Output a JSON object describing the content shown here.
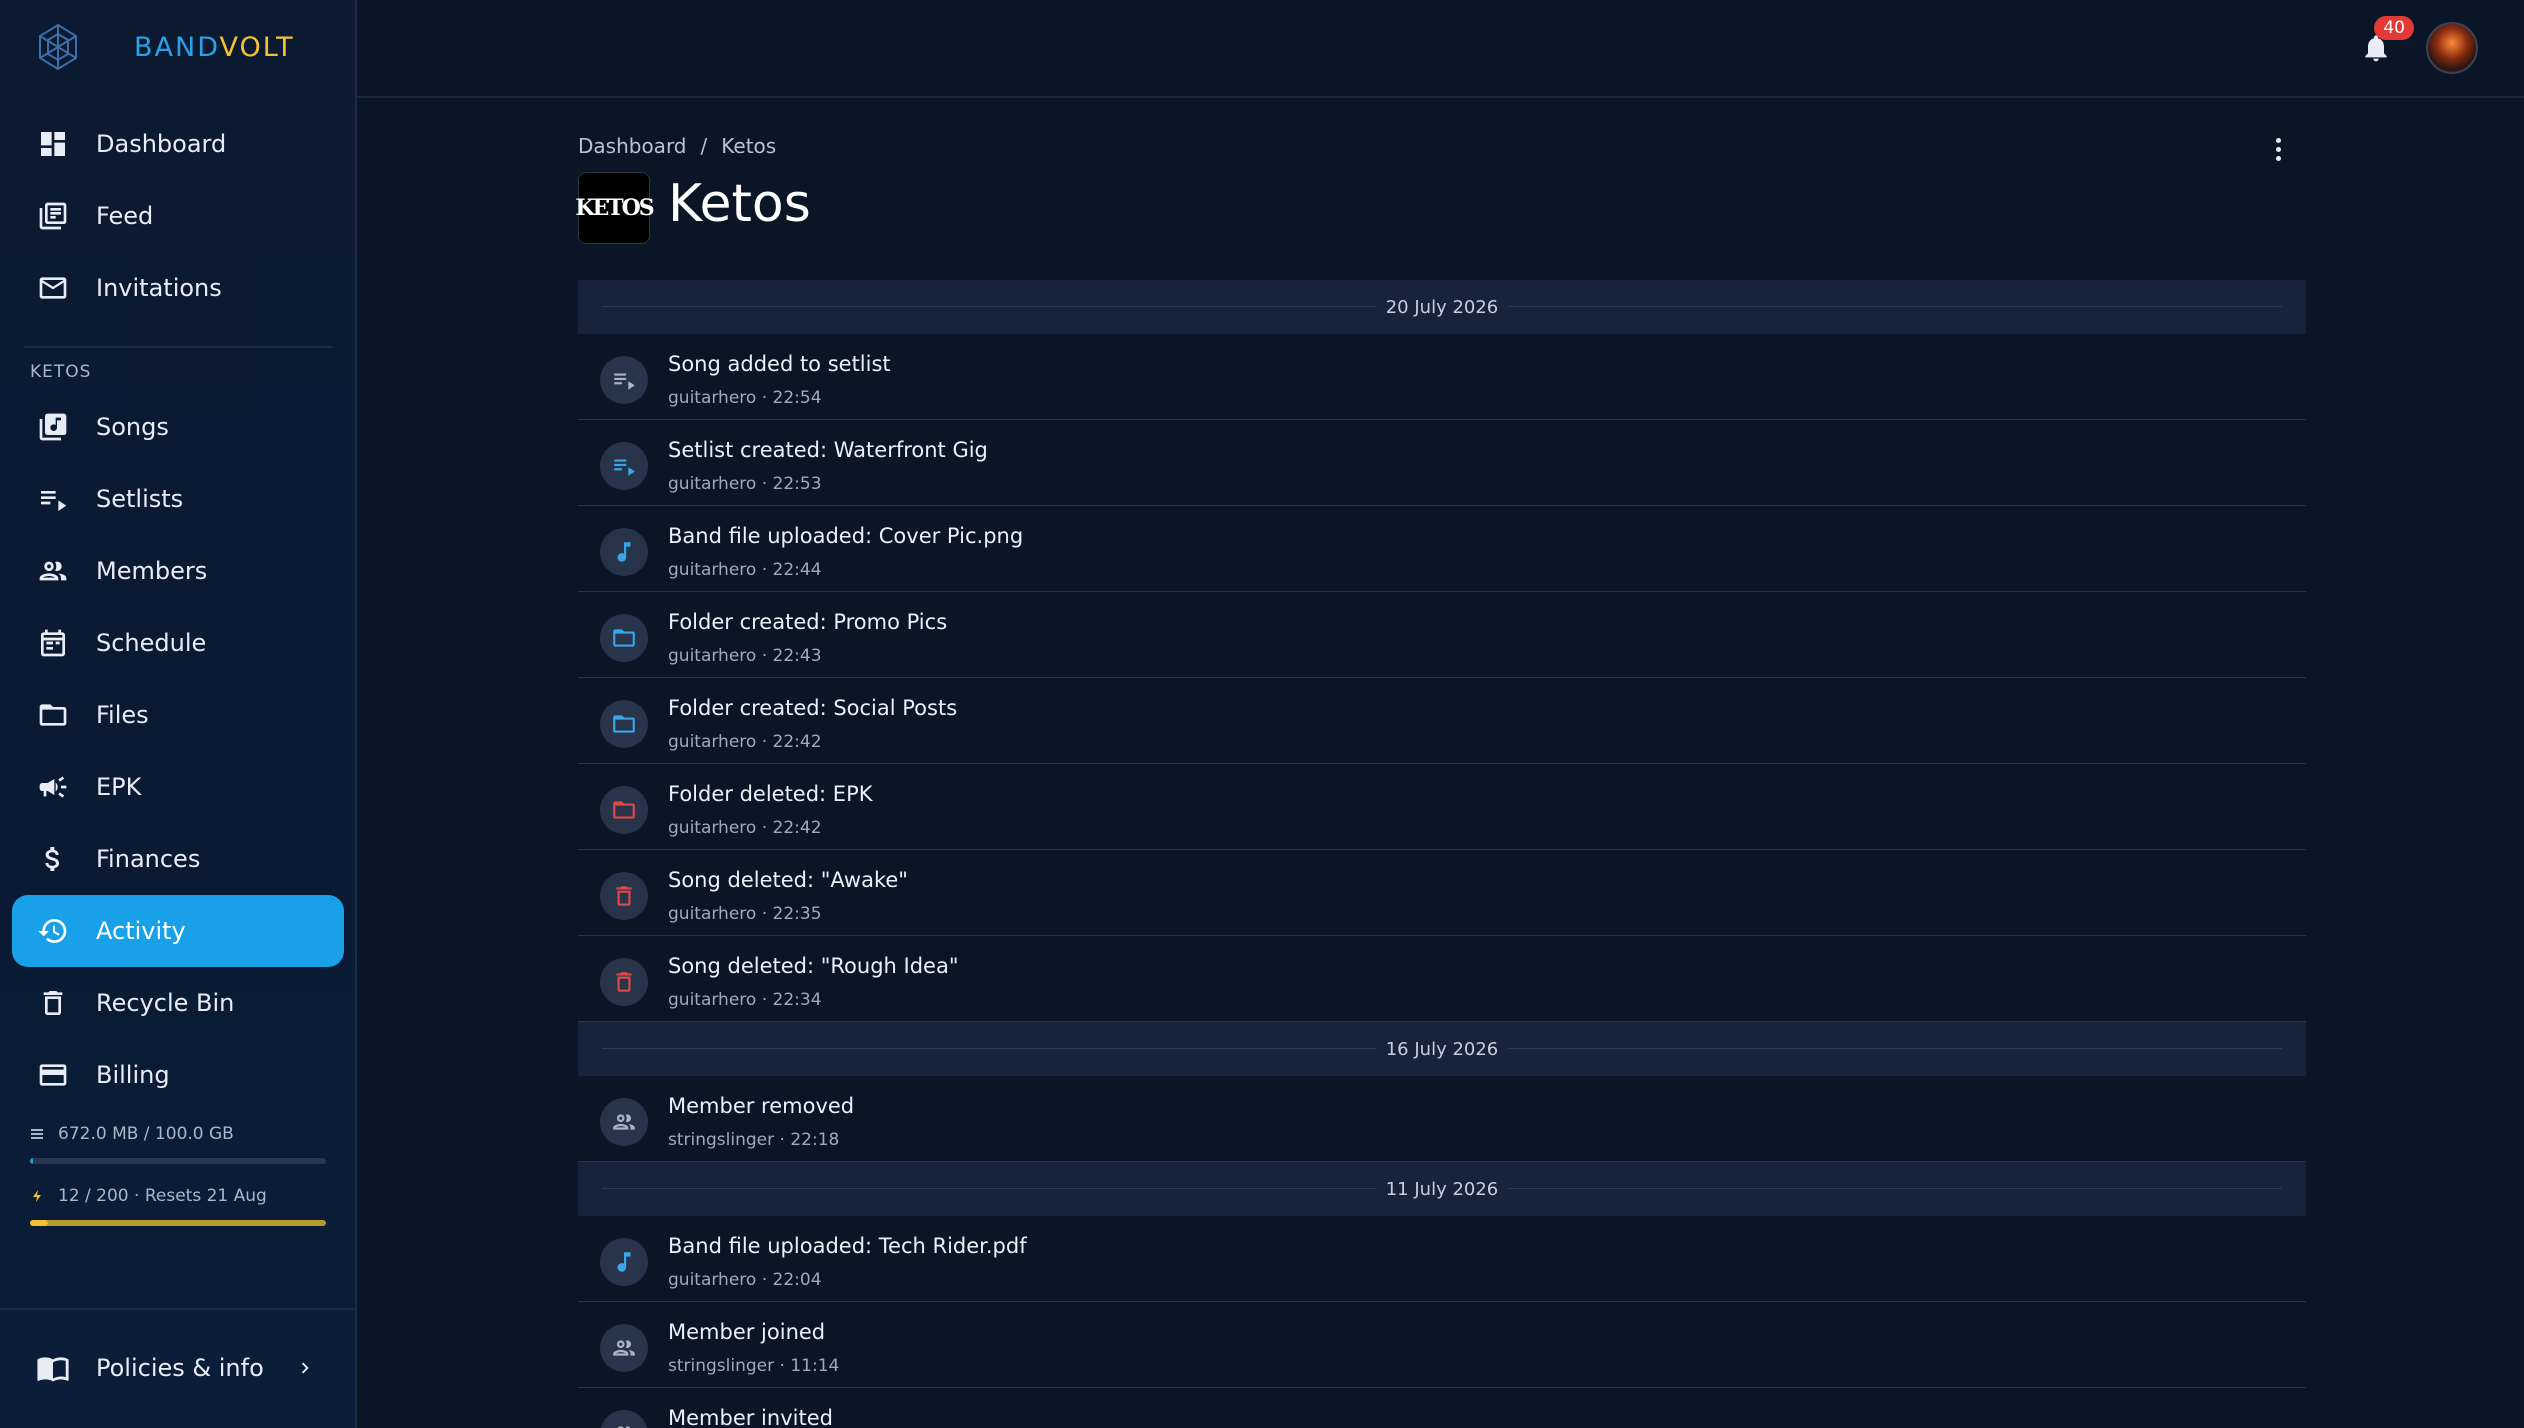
{
  "brand": {
    "part1": "BAND",
    "part2": "VOLT"
  },
  "sidebar": {
    "main_items": [
      {
        "label": "Dashboard",
        "icon": "dashboard-icon"
      },
      {
        "label": "Feed",
        "icon": "feed-icon"
      },
      {
        "label": "Invitations",
        "icon": "mail-icon"
      }
    ],
    "section_label": "KETOS",
    "band_items": [
      {
        "label": "Songs",
        "icon": "music-library-icon"
      },
      {
        "label": "Setlists",
        "icon": "playlist-icon"
      },
      {
        "label": "Members",
        "icon": "people-icon"
      },
      {
        "label": "Schedule",
        "icon": "calendar-icon"
      },
      {
        "label": "Files",
        "icon": "folder-icon"
      },
      {
        "label": "EPK",
        "icon": "megaphone-icon"
      },
      {
        "label": "Finances",
        "icon": "dollar-icon"
      },
      {
        "label": "Activity",
        "icon": "history-icon",
        "active": true
      },
      {
        "label": "Recycle Bin",
        "icon": "trash-icon"
      },
      {
        "label": "Billing",
        "icon": "credit-card-icon"
      }
    ],
    "storage": {
      "text": "672.0 MB / 100.0 GB",
      "fraction": 0.0066
    },
    "credits": {
      "text": "12 / 200 · Resets 21 Aug",
      "fraction": 0.06
    },
    "policies_label": "Policies & info"
  },
  "header": {
    "notification_count": "40"
  },
  "breadcrumb": {
    "root": "Dashboard",
    "separator": "/",
    "current": "Ketos"
  },
  "band": {
    "logo_text": "KETOS",
    "title": "Ketos"
  },
  "colors": {
    "accent": "#18a0e8",
    "danger": "#e04848",
    "brand_yellow": "#f2c232"
  },
  "feed": [
    {
      "date": "20 July 2026",
      "entries": [
        {
          "title": "Song added to setlist",
          "meta": "guitarhero · 22:54",
          "icon": "playlist-icon",
          "color": "#a9b4c4"
        },
        {
          "title": "Setlist created: Waterfront Gig",
          "meta": "guitarhero · 22:53",
          "icon": "playlist-icon",
          "color": "#3aa6ea"
        },
        {
          "title": "Band file uploaded: Cover Pic.png",
          "meta": "guitarhero · 22:44",
          "icon": "music-note-icon",
          "color": "#3aa6ea"
        },
        {
          "title": "Folder created: Promo Pics",
          "meta": "guitarhero · 22:43",
          "icon": "folder-icon",
          "color": "#3aa6ea"
        },
        {
          "title": "Folder created: Social Posts",
          "meta": "guitarhero · 22:42",
          "icon": "folder-icon",
          "color": "#3aa6ea"
        },
        {
          "title": "Folder deleted: EPK",
          "meta": "guitarhero · 22:42",
          "icon": "folder-icon",
          "color": "#e04848"
        },
        {
          "title": "Song deleted: \"Awake\"",
          "meta": "guitarhero · 22:35",
          "icon": "trash-icon",
          "color": "#e04848"
        },
        {
          "title": "Song deleted: \"Rough Idea\"",
          "meta": "guitarhero · 22:34",
          "icon": "trash-icon",
          "color": "#e04848"
        }
      ]
    },
    {
      "date": "16 July 2026",
      "entries": [
        {
          "title": "Member removed",
          "meta": "stringslinger · 22:18",
          "icon": "people-icon",
          "color": "#a9b4c4"
        }
      ]
    },
    {
      "date": "11 July 2026",
      "entries": [
        {
          "title": "Band file uploaded: Tech Rider.pdf",
          "meta": "guitarhero · 22:04",
          "icon": "music-note-icon",
          "color": "#3aa6ea"
        },
        {
          "title": "Member joined",
          "meta": "stringslinger · 11:14",
          "icon": "people-icon",
          "color": "#a9b4c4"
        },
        {
          "title": "Member invited",
          "meta": "",
          "icon": "people-icon",
          "color": "#a9b4c4"
        }
      ]
    }
  ]
}
